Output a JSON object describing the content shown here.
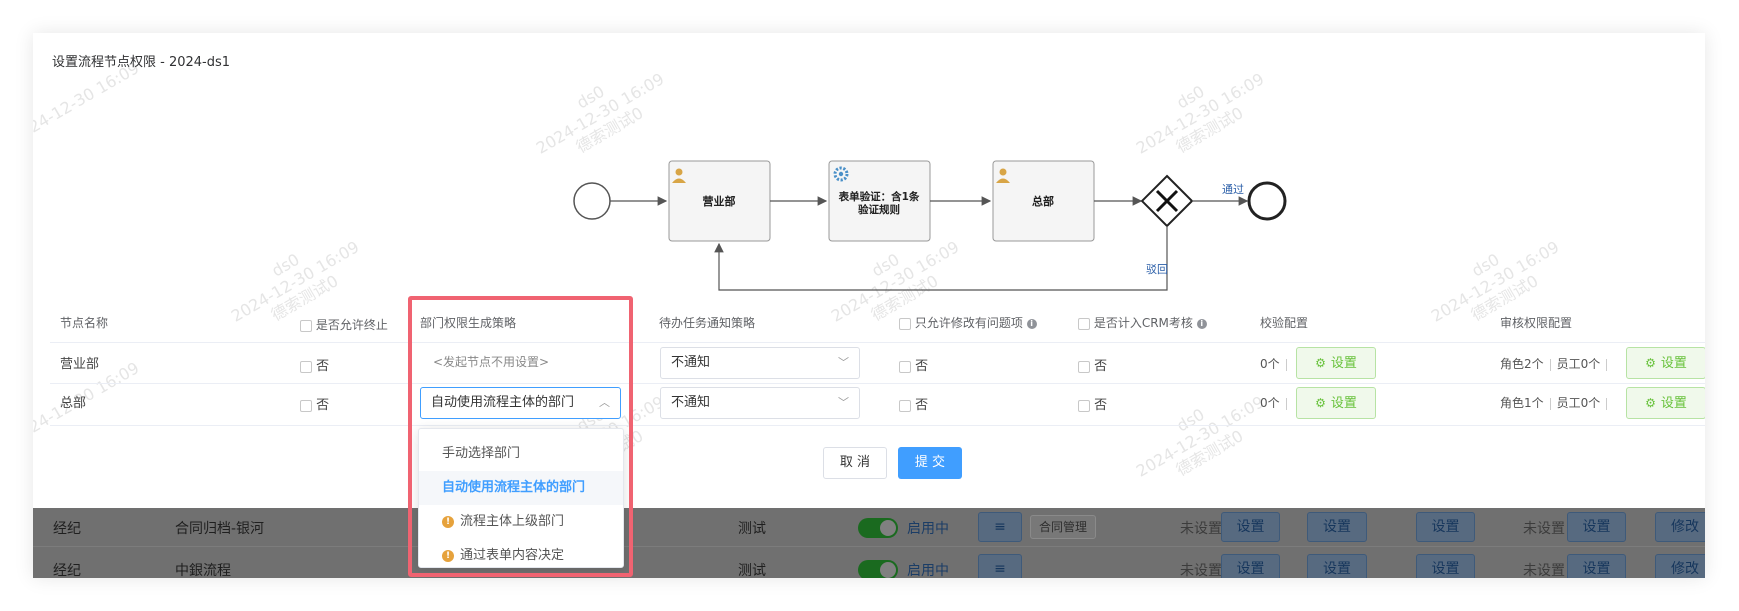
{
  "dialog": {
    "title": "设置流程节点权限 - 2024-ds1"
  },
  "watermark": {
    "user": "ds0",
    "time": "2024-12-30 16:09",
    "name": "德索测试0"
  },
  "flow": {
    "node1": "营业部",
    "node2_line1": "表单验证：含1条",
    "node2_line2": "验证规则",
    "node3": "总部",
    "pass_label": "通过",
    "reject_label": "驳回"
  },
  "table": {
    "headers": {
      "node_name": "节点名称",
      "allow_terminate": "是否允许终止",
      "dept_strategy": "部门权限生成策略",
      "todo_notify": "待办任务通知策略",
      "only_modify": "只允许修改有问题项",
      "crm": "是否计入CRM考核",
      "verify_config": "校验配置",
      "audit_config": "审核权限配置"
    },
    "rows": [
      {
        "name": "营业部",
        "allow_terminate": "否",
        "dept_strategy": "<发起节点不用设置>",
        "todo_notify": "不通知",
        "only_modify": "否",
        "crm": "否",
        "verify_count": "0个",
        "verify_btn": "设置",
        "roles": "角色2个",
        "staff": "员工0个",
        "audit_btn": "设置"
      },
      {
        "name": "总部",
        "allow_terminate": "否",
        "dept_strategy": "自动使用流程主体的部门",
        "todo_notify": "不通知",
        "only_modify": "否",
        "crm": "否",
        "verify_count": "0个",
        "verify_btn": "设置",
        "roles": "角色1个",
        "staff": "员工0个",
        "audit_btn": "设置"
      }
    ]
  },
  "actions": {
    "cancel": "取 消",
    "submit": "提 交"
  },
  "dropdown": {
    "options": [
      "手动选择部门",
      "自动使用流程主体的部门",
      "流程主体上级部门",
      "通过表单内容决定"
    ],
    "selected_index": 1
  },
  "background_rows": [
    {
      "c1": "经纪",
      "c2": "合同归档-银河",
      "c3": "测试",
      "status": "启用中",
      "tag": "合同管理",
      "unset1": "未设置",
      "btn1": "设置",
      "btn2": "设置",
      "btn3": "设置",
      "unset2": "未设置",
      "btn4": "设置",
      "btn5": "修改"
    },
    {
      "c1": "经纪",
      "c2": "中銀流程",
      "c3": "测试",
      "status": "启用中",
      "unset1": "未设置",
      "btn1": "设置",
      "btn2": "设置",
      "btn3": "设置",
      "unset2": "未设置",
      "btn4": "设置",
      "btn5": "修改"
    }
  ],
  "colors": {
    "primary": "#409eff",
    "success": "#67c23a",
    "highlight_border": "#f06371",
    "warning": "#e6a23c"
  }
}
